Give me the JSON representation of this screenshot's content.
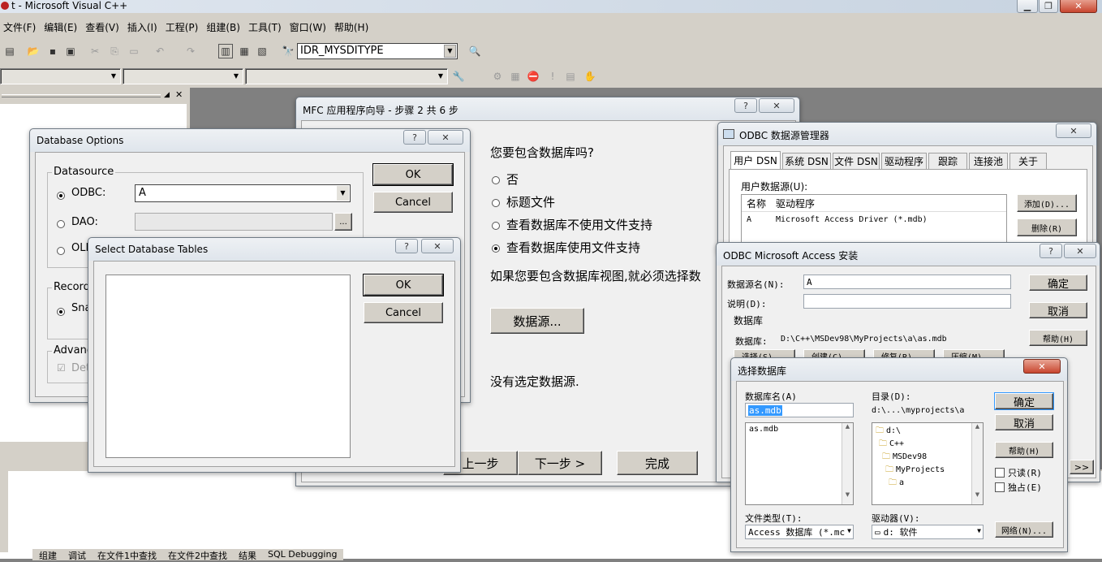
{
  "app": {
    "title": "t - Microsoft Visual C++"
  },
  "menu": [
    "文件(F)",
    "编辑(E)",
    "查看(V)",
    "插入(I)",
    "工程(P)",
    "组建(B)",
    "工具(T)",
    "窗口(W)",
    "帮助(H)"
  ],
  "toolbar": {
    "resource_combo": "IDR_MYSDITYPE"
  },
  "output_tabs": [
    "组建",
    "调试",
    "在文件1中查找",
    "在文件2中查找",
    "结果",
    "SQL Debugging"
  ],
  "wizard": {
    "title": "MFC 应用程序向导 - 步骤 2 共 6 步",
    "question": "您要包含数据库吗?",
    "options": [
      "否",
      "标题文件",
      "查看数据库不使用文件支持",
      "查看数据库使用文件支持"
    ],
    "selected_index": 3,
    "views_note": "如果您要包含数据库视图,就必须选择数",
    "datasource_button": "数据源...",
    "no_datasource": "没有选定数据源.",
    "back_button": "上一步",
    "next_button": "下一步 >",
    "finish_button": "完成"
  },
  "db_options": {
    "title": "Database Options",
    "datasource_group": "Datasource",
    "odbc_label": "ODBC:",
    "odbc_value": "A",
    "dao_label": "DAO:",
    "oledb_label": "OLE",
    "recordset_group": "Recordset",
    "snapshot_label": "Sna",
    "advanced_group": "Advanced",
    "detect_label": "Det",
    "ok": "OK",
    "cancel": "Cancel"
  },
  "select_tables": {
    "title": "Select Database Tables",
    "ok": "OK",
    "cancel": "Cancel"
  },
  "odbc_manager": {
    "title": "ODBC 数据源管理器",
    "tabs": [
      "用户 DSN",
      "系统 DSN",
      "文件 DSN",
      "驱动程序",
      "跟踪",
      "连接池",
      "关于"
    ],
    "user_ds_label": "用户数据源(U):",
    "col_name": "名称",
    "col_driver": "驱动程序",
    "row_name": "A",
    "row_driver": "Microsoft Access Driver (*.mdb)",
    "add": "添加(D)...",
    "remove": "删除(R)"
  },
  "access_setup": {
    "title": "ODBC Microsoft Access 安装",
    "dsn_label": "数据源名(N):",
    "dsn_value": "A",
    "desc_label": "说明(D):",
    "db_group": "数据库",
    "db_path_label": "数据库:",
    "db_path": "D:\\C++\\MSDev98\\MyProjects\\a\\as.mdb",
    "select": "选择(S)...",
    "create": "创建(C)...",
    "repair": "修复(R)...",
    "compact": "压缩(M)...",
    "ok": "确定",
    "cancel": "取消",
    "help": "帮助(H)",
    "advanced": ">>"
  },
  "select_db": {
    "title": "选择数据库",
    "db_name_label": "数据库名(A)",
    "db_name_value": "as.mdb",
    "files": [
      "as.mdb"
    ],
    "dir_label": "目录(D):",
    "dir_value": "d:\\...\\myprojects\\a",
    "dirs": [
      "d:\\",
      "C++",
      "MSDev98",
      "MyProjects",
      "a"
    ],
    "ok": "确定",
    "cancel": "取消",
    "help": "帮助(H)",
    "readonly": "只读(R)",
    "exclusive": "独占(E)",
    "filetype_label": "文件类型(T):",
    "filetype_value": "Access 数据库 (*.mc",
    "drive_label": "驱动器(V):",
    "drive_value": "d: 软件",
    "network": "网络(N)..."
  },
  "colors": {
    "accent": "#3399ff",
    "close": "#c8452f"
  }
}
